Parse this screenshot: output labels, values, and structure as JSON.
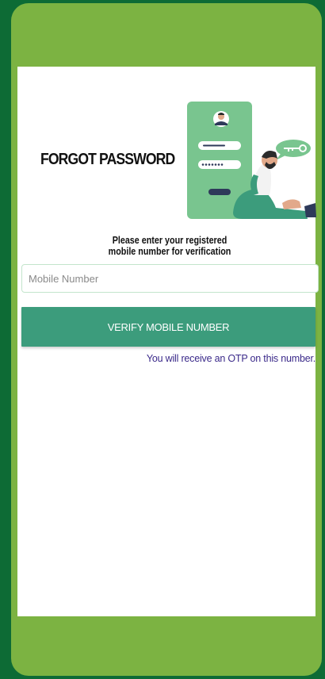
{
  "page": {
    "title": "FORGOT PASSWORD",
    "prompt_line1": "Please enter your registered",
    "prompt_line2": "mobile number for verification"
  },
  "form": {
    "mobile_placeholder": "Mobile Number",
    "mobile_value": "",
    "verify_label": "VERIFY MOBILE NUMBER",
    "hint": "You will receive an OTP on this number."
  },
  "illustration": {
    "icons": [
      "user-avatar-icon",
      "password-field-icon",
      "key-icon",
      "person-sitting-icon"
    ]
  },
  "colors": {
    "outer_bg": "#0d6b35",
    "frame_bg": "#7cb342",
    "accent": "#3c9c7c",
    "hint_text": "#3b2a8a"
  }
}
